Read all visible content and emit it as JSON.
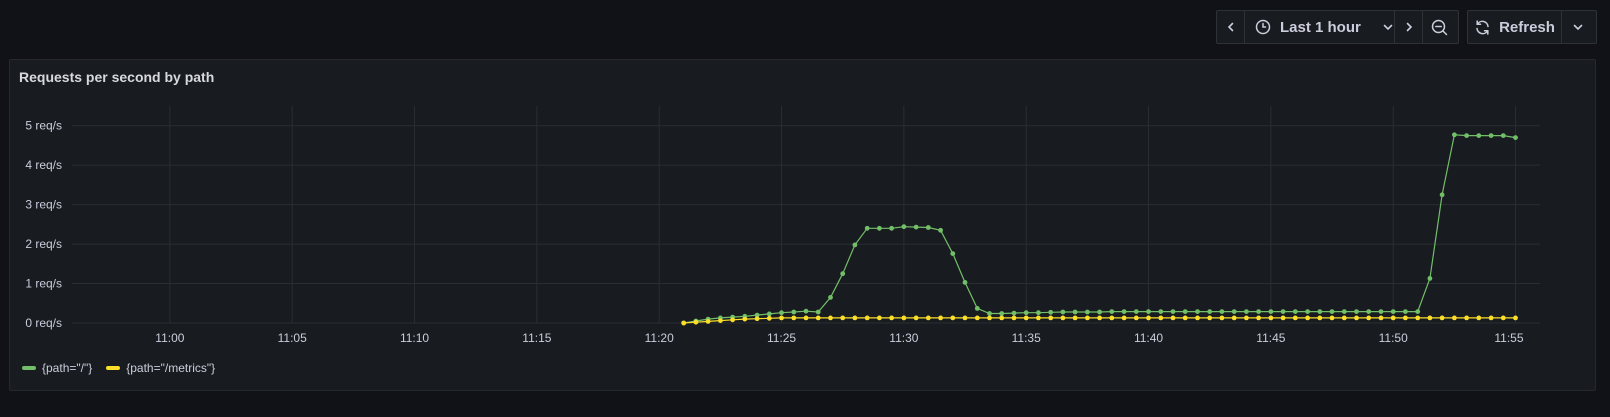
{
  "toolbar": {
    "time_range_label": "Last 1 hour",
    "refresh_label": "Refresh",
    "icons": {
      "prev": "chevron-left-icon",
      "clock": "clock-icon",
      "time_dropdown": "chevron-down-icon",
      "next": "chevron-right-icon",
      "zoom_out": "zoom-out-icon",
      "refresh": "refresh-icon",
      "refresh_dropdown": "chevron-down-icon"
    }
  },
  "panel": {
    "title": "Requests per second by path"
  },
  "colors": {
    "background": "#111217",
    "panel": "#181b1f",
    "grid": "#2a2d33",
    "series_root": "#73bf69",
    "series_metrics": "#fade2a"
  },
  "chart_data": {
    "type": "line",
    "title": "Requests per second by path",
    "xlabel": "",
    "ylabel": "",
    "x_range": [
      "10:56",
      "11:56"
    ],
    "ylim": [
      0,
      5.5
    ],
    "y_ticks": [
      0,
      1,
      2,
      3,
      4,
      5
    ],
    "y_tick_labels": [
      "0 req/s",
      "1 req/s",
      "2 req/s",
      "3 req/s",
      "4 req/s",
      "5 req/s"
    ],
    "x_ticks": [
      "11:00",
      "11:05",
      "11:10",
      "11:15",
      "11:20",
      "11:25",
      "11:30",
      "11:35",
      "11:40",
      "11:45",
      "11:50",
      "11:55"
    ],
    "grid": true,
    "legend_position": "bottom-left",
    "series": [
      {
        "name": "{path=\"/\"}",
        "color": "#73bf69",
        "x": [
          "11:21:00",
          "11:21:30",
          "11:22:00",
          "11:22:30",
          "11:23:00",
          "11:23:30",
          "11:24:00",
          "11:24:30",
          "11:25:00",
          "11:25:30",
          "11:26:00",
          "11:26:30",
          "11:27:00",
          "11:27:30",
          "11:28:00",
          "11:28:30",
          "11:29:00",
          "11:29:30",
          "11:30:00",
          "11:30:30",
          "11:31:00",
          "11:31:30",
          "11:32:00",
          "11:32:30",
          "11:33:00",
          "11:33:30",
          "11:34:00",
          "11:34:30",
          "11:35:00",
          "11:35:30",
          "11:36:00",
          "11:36:30",
          "11:37:00",
          "11:37:30",
          "11:38:00",
          "11:38:30",
          "11:39:00",
          "11:39:30",
          "11:40:00",
          "11:40:30",
          "11:41:00",
          "11:41:30",
          "11:42:00",
          "11:42:30",
          "11:43:00",
          "11:43:30",
          "11:44:00",
          "11:44:30",
          "11:45:00",
          "11:45:30",
          "11:46:00",
          "11:46:30",
          "11:47:00",
          "11:47:30",
          "11:48:00",
          "11:48:30",
          "11:49:00",
          "11:49:30",
          "11:50:00",
          "11:50:30",
          "11:51:00",
          "11:51:30",
          "11:52:00",
          "11:52:30",
          "11:53:00",
          "11:53:30",
          "11:54:00",
          "11:54:30",
          "11:55:00"
        ],
        "values": [
          0.0,
          0.05,
          0.1,
          0.13,
          0.15,
          0.17,
          0.2,
          0.23,
          0.26,
          0.28,
          0.3,
          0.28,
          0.65,
          1.25,
          1.98,
          2.4,
          2.4,
          2.4,
          2.44,
          2.43,
          2.42,
          2.35,
          1.76,
          1.03,
          0.37,
          0.24,
          0.24,
          0.25,
          0.26,
          0.26,
          0.27,
          0.28,
          0.28,
          0.28,
          0.28,
          0.29,
          0.29,
          0.29,
          0.29,
          0.29,
          0.29,
          0.29,
          0.29,
          0.29,
          0.29,
          0.29,
          0.29,
          0.29,
          0.29,
          0.29,
          0.29,
          0.29,
          0.29,
          0.29,
          0.29,
          0.29,
          0.29,
          0.29,
          0.29,
          0.29,
          0.29,
          1.13,
          3.25,
          4.77,
          4.75,
          4.75,
          4.75,
          4.75,
          4.7
        ]
      },
      {
        "name": "{path=\"/metrics\"}",
        "color": "#fade2a",
        "x": [
          "11:21:00",
          "11:21:30",
          "11:22:00",
          "11:22:30",
          "11:23:00",
          "11:23:30",
          "11:24:00",
          "11:24:30",
          "11:25:00",
          "11:25:30",
          "11:26:00",
          "11:26:30",
          "11:27:00",
          "11:27:30",
          "11:28:00",
          "11:28:30",
          "11:29:00",
          "11:29:30",
          "11:30:00",
          "11:30:30",
          "11:31:00",
          "11:31:30",
          "11:32:00",
          "11:32:30",
          "11:33:00",
          "11:33:30",
          "11:34:00",
          "11:34:30",
          "11:35:00",
          "11:35:30",
          "11:36:00",
          "11:36:30",
          "11:37:00",
          "11:37:30",
          "11:38:00",
          "11:38:30",
          "11:39:00",
          "11:39:30",
          "11:40:00",
          "11:40:30",
          "11:41:00",
          "11:41:30",
          "11:42:00",
          "11:42:30",
          "11:43:00",
          "11:43:30",
          "11:44:00",
          "11:44:30",
          "11:45:00",
          "11:45:30",
          "11:46:00",
          "11:46:30",
          "11:47:00",
          "11:47:30",
          "11:48:00",
          "11:48:30",
          "11:49:00",
          "11:49:30",
          "11:50:00",
          "11:50:30",
          "11:51:00",
          "11:51:30",
          "11:52:00",
          "11:52:30",
          "11:53:00",
          "11:53:30",
          "11:54:00",
          "11:54:30",
          "11:55:00"
        ],
        "values": [
          0.0,
          0.02,
          0.04,
          0.06,
          0.08,
          0.1,
          0.11,
          0.12,
          0.13,
          0.13,
          0.13,
          0.13,
          0.13,
          0.13,
          0.13,
          0.13,
          0.13,
          0.13,
          0.13,
          0.13,
          0.13,
          0.13,
          0.13,
          0.13,
          0.13,
          0.13,
          0.13,
          0.13,
          0.13,
          0.13,
          0.13,
          0.13,
          0.13,
          0.13,
          0.13,
          0.13,
          0.13,
          0.13,
          0.13,
          0.13,
          0.13,
          0.13,
          0.13,
          0.13,
          0.13,
          0.13,
          0.13,
          0.13,
          0.13,
          0.13,
          0.13,
          0.13,
          0.13,
          0.13,
          0.13,
          0.13,
          0.13,
          0.13,
          0.13,
          0.13,
          0.13,
          0.13,
          0.13,
          0.13,
          0.13,
          0.13,
          0.13,
          0.13,
          0.13
        ]
      }
    ]
  }
}
